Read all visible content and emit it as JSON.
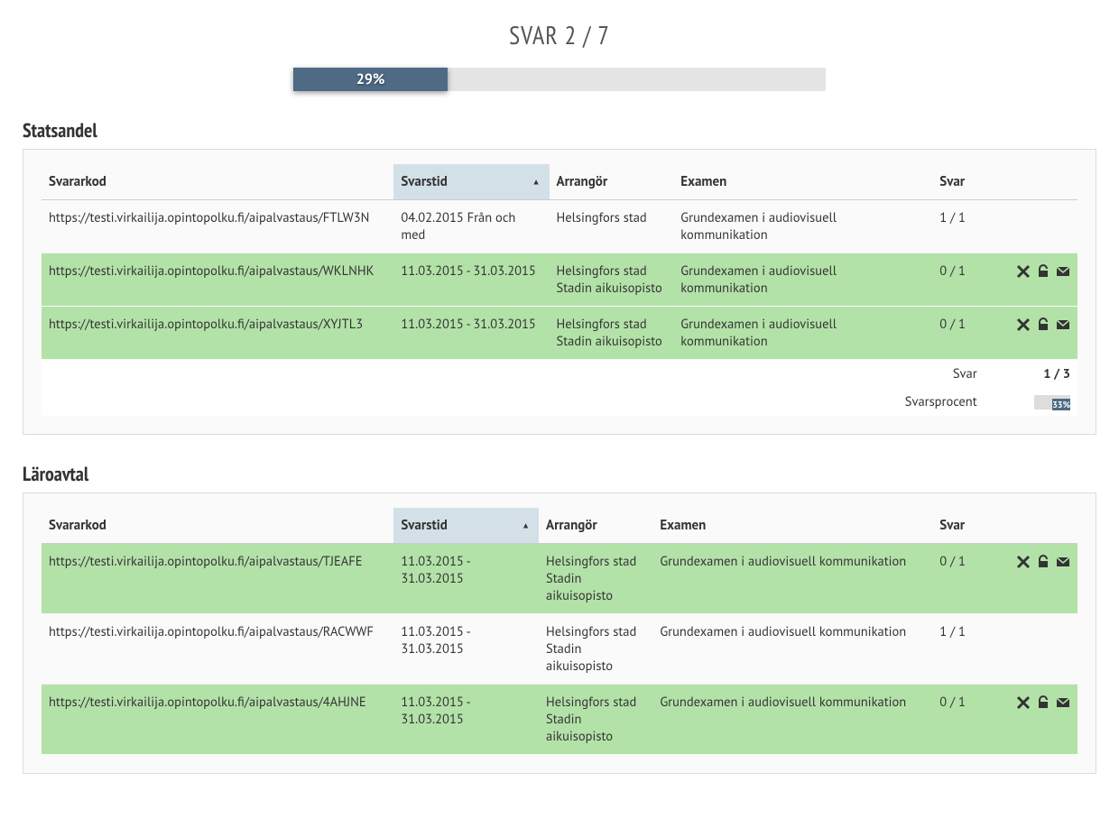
{
  "header": {
    "title": "SVAR 2 / 7",
    "progress_percent": 29,
    "progress_label": "29%"
  },
  "sections": [
    {
      "title": "Statsandel",
      "columns": {
        "code": "Svararkod",
        "time": "Svarstid",
        "org": "Arrangör",
        "exam": "Examen",
        "svar": "Svar"
      },
      "rows": [
        {
          "highlight": false,
          "code": "https://testi.virkailija.opintopolku.fi/aipalvastaus/FTLW3N",
          "time": "04.02.2015 Från och med",
          "org": "Helsingfors stad",
          "exam": "Grundexamen i audiovisuell kommunikation",
          "svar": "1 / 1",
          "actions": false
        },
        {
          "highlight": true,
          "code": "https://testi.virkailija.opintopolku.fi/aipalvastaus/WKLNHK",
          "time": "11.03.2015 - 31.03.2015",
          "org": "Helsingfors stad Stadin aikuisopisto",
          "exam": "Grundexamen i audiovisuell kommunikation",
          "svar": "0 / 1",
          "actions": true
        },
        {
          "highlight": true,
          "code": "https://testi.virkailija.opintopolku.fi/aipalvastaus/XYJTL3",
          "time": "11.03.2015 - 31.03.2015",
          "org": "Helsingfors stad Stadin aikuisopisto",
          "exam": "Grundexamen i audiovisuell kommunikation",
          "svar": "0 / 1",
          "actions": true
        }
      ],
      "summary": {
        "svar_label": "Svar",
        "svar_value": "1 / 3",
        "percent_label": "Svarsprocent",
        "percent_value": "33%",
        "percent_fill": 33
      }
    },
    {
      "title": "Läroavtal",
      "columns": {
        "code": "Svararkod",
        "time": "Svarstid",
        "org": "Arrangör",
        "exam": "Examen",
        "svar": "Svar"
      },
      "rows": [
        {
          "highlight": true,
          "code": "https://testi.virkailija.opintopolku.fi/aipalvastaus/TJEAFE",
          "time": "11.03.2015 - 31.03.2015",
          "org": "Helsingfors stad Stadin aikuisopisto",
          "exam": "Grundexamen i audiovisuell kommunikation",
          "svar": "0 / 1",
          "actions": true
        },
        {
          "highlight": false,
          "code": "https://testi.virkailija.opintopolku.fi/aipalvastaus/RACWWF",
          "time": "11.03.2015 - 31.03.2015",
          "org": "Helsingfors stad Stadin aikuisopisto",
          "exam": "Grundexamen i audiovisuell kommunikation",
          "svar": "1 / 1",
          "actions": false
        },
        {
          "highlight": true,
          "code": "https://testi.virkailija.opintopolku.fi/aipalvastaus/4AHJNE",
          "time": "11.03.2015 - 31.03.2015",
          "org": "Helsingfors stad Stadin aikuisopisto",
          "exam": "Grundexamen i audiovisuell kommunikation",
          "svar": "0 / 1",
          "actions": true
        }
      ],
      "summary": null
    }
  ]
}
